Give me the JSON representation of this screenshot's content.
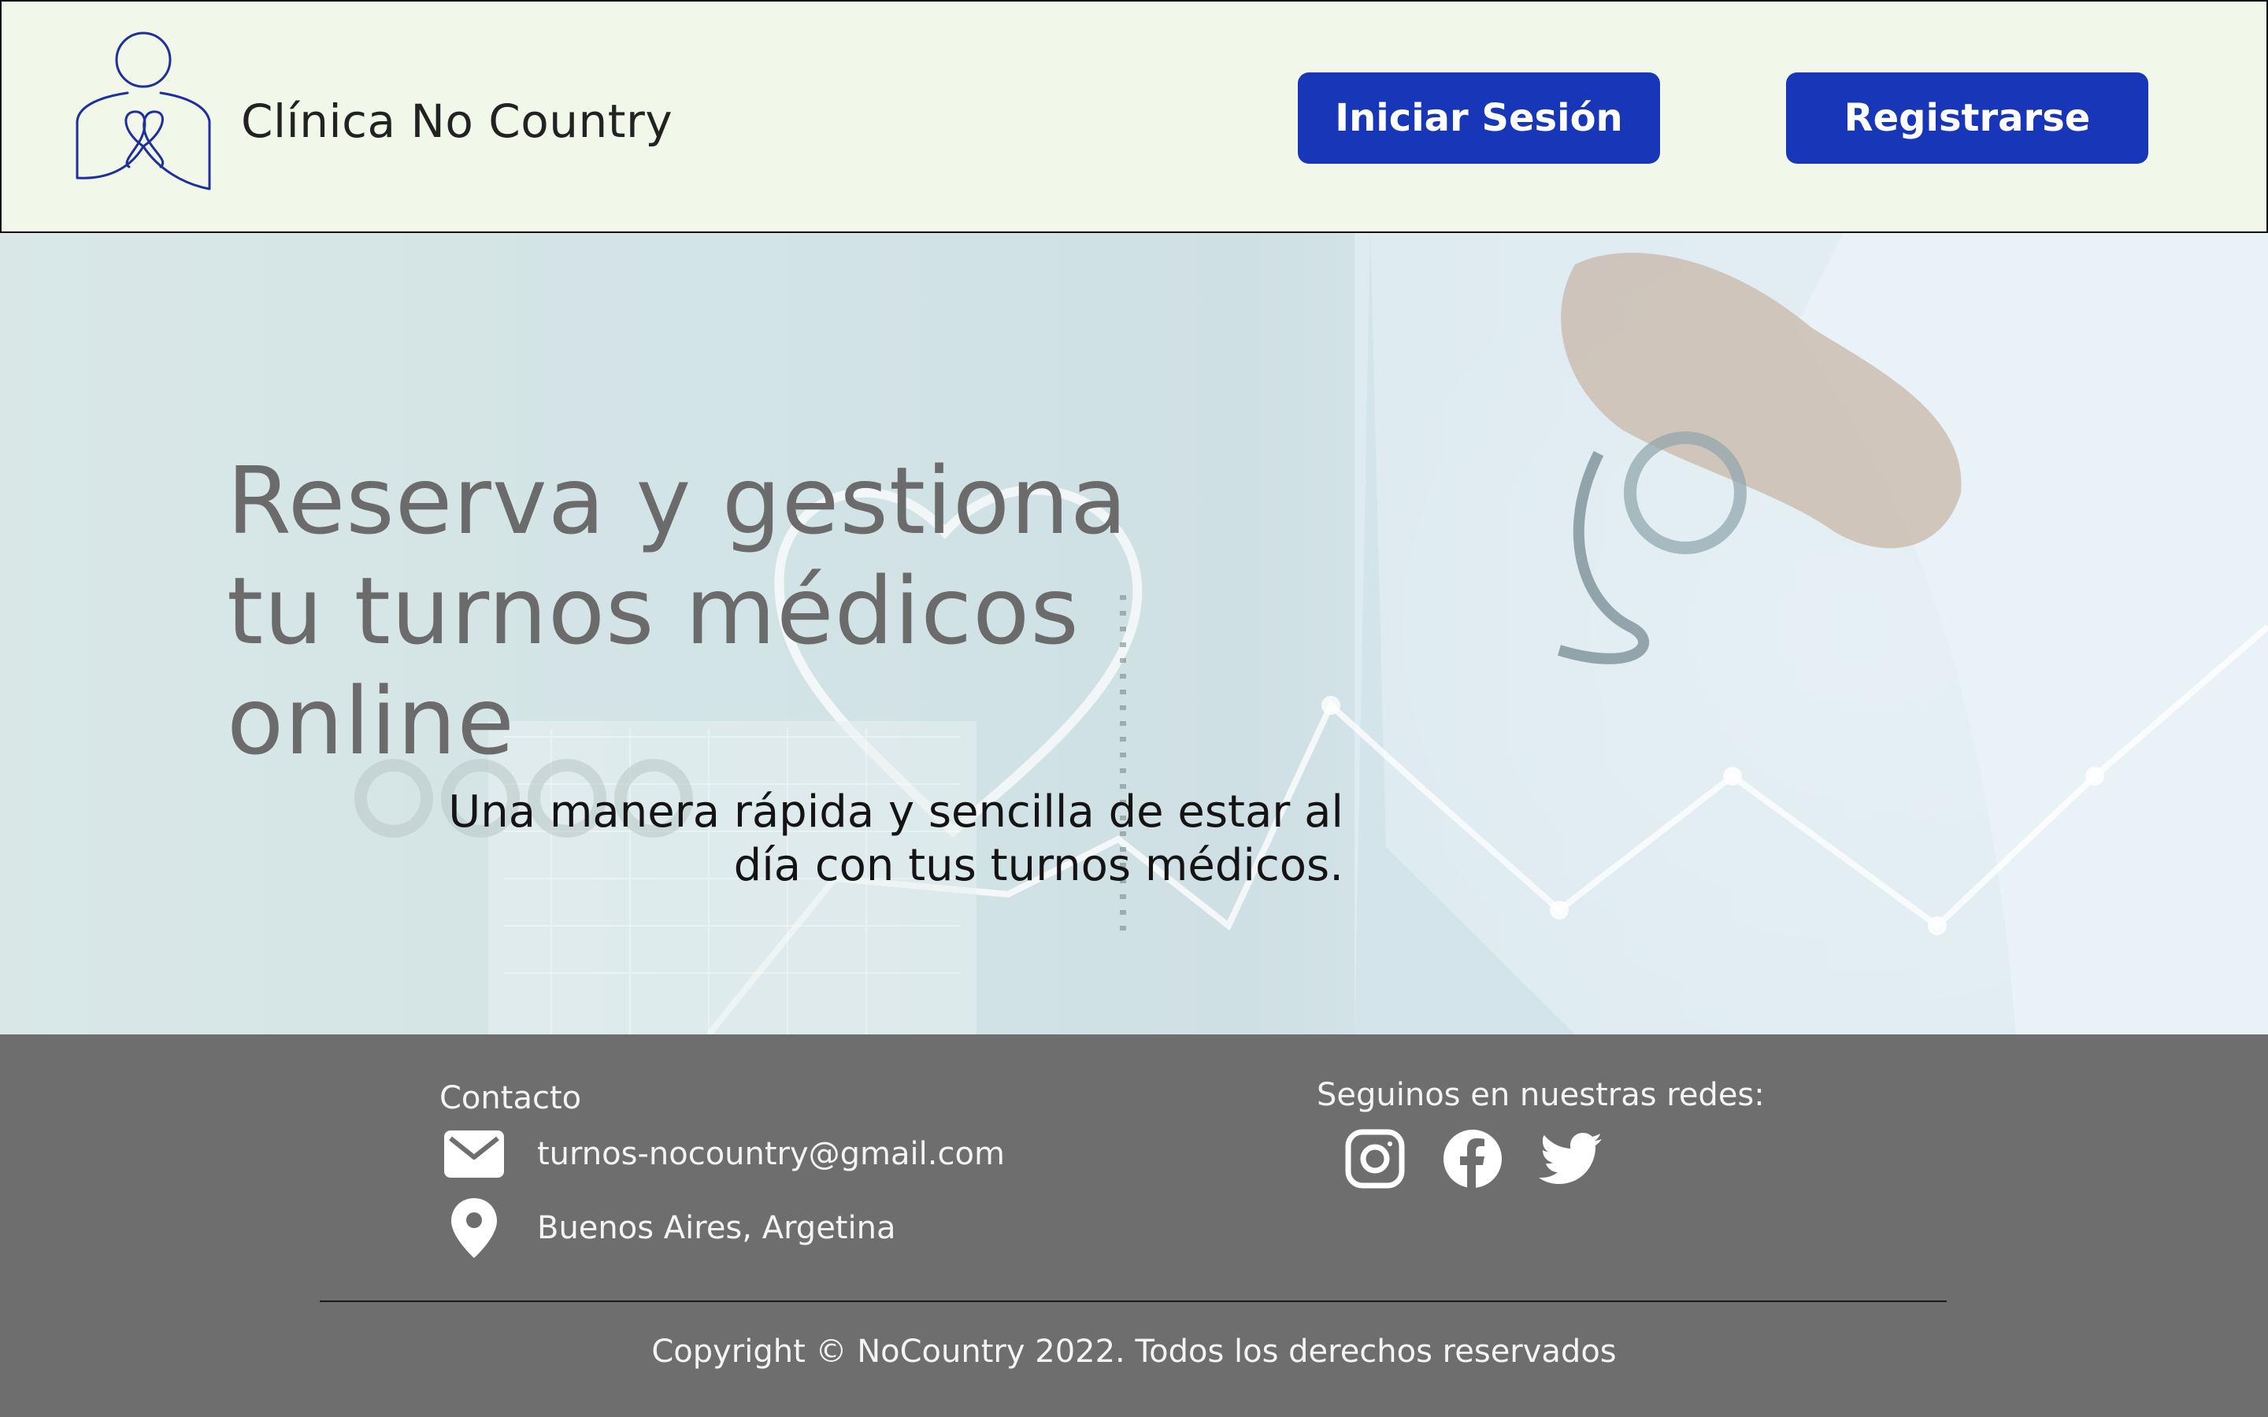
{
  "header": {
    "brand": "Clínica No Country",
    "login_label": "Iniciar Sesión",
    "register_label": "Registrarse"
  },
  "hero": {
    "title_lines": [
      "Reserva y gestiona",
      "tu turnos médicos",
      "online"
    ],
    "subtitle_lines": [
      "Una manera rápida y sencilla de estar al",
      "día con tus turnos médicos."
    ]
  },
  "footer": {
    "contact_title": "Contacto",
    "email": "turnos-nocountry@gmail.com",
    "location": "Buenos Aires, Argetina",
    "social_title": "Seguinos en nuestras redes:",
    "social_icons": [
      "instagram-icon",
      "facebook-icon",
      "twitter-icon"
    ],
    "copyright": "Copyright © NoCountry 2022. Todos los derechos reservados"
  },
  "colors": {
    "header_bg": "#f1f8e9",
    "button_bg": "#1736b8",
    "footer_bg": "#6e6e6e",
    "logo_stroke": "#1f2f9c"
  }
}
